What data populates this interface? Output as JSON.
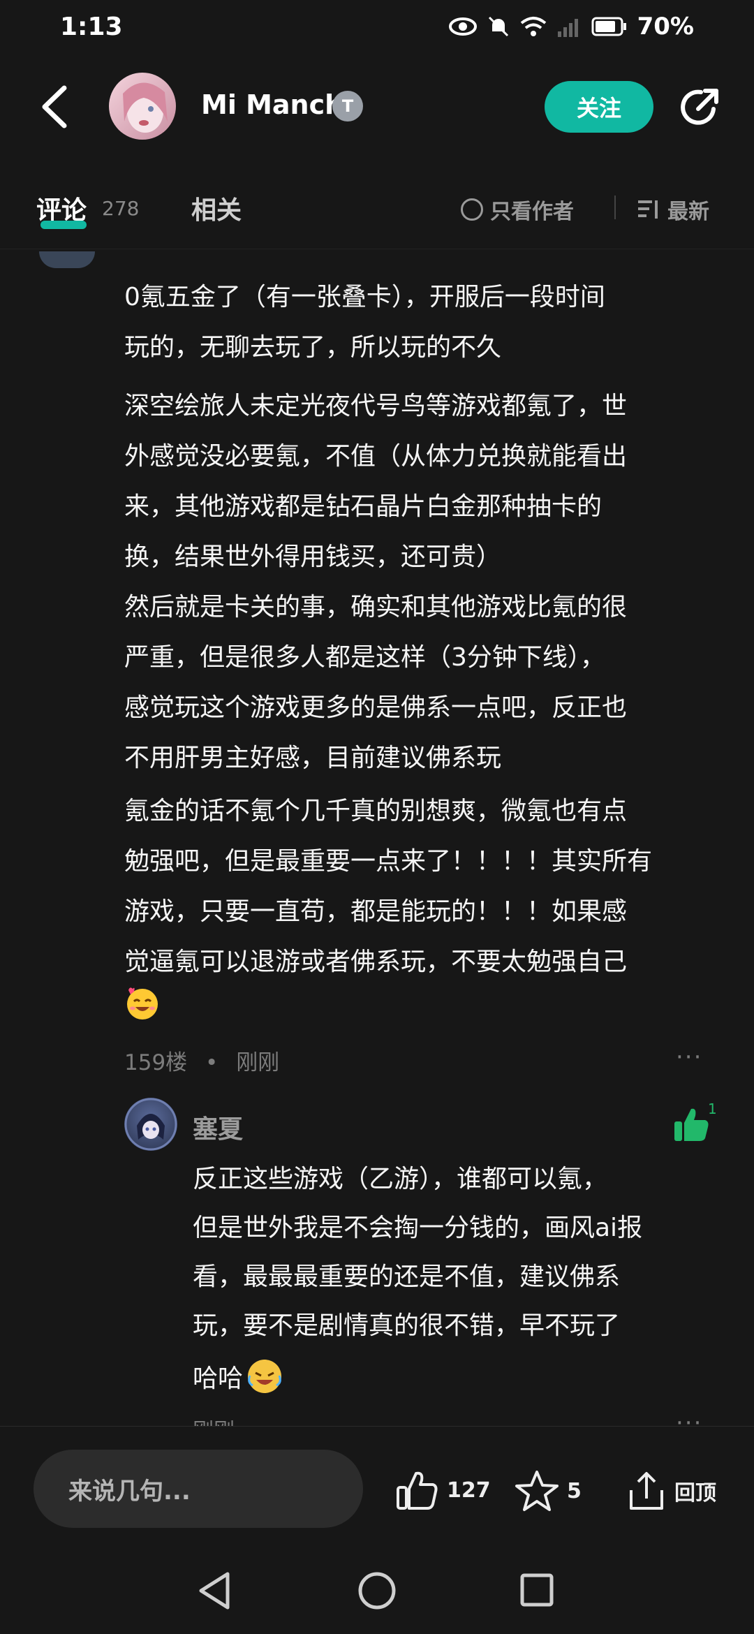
{
  "status_bar": {
    "time": "1:13",
    "battery": "70%"
  },
  "header": {
    "username": "Mi Manchi",
    "follow_label": "关注"
  },
  "tabs": {
    "comments_label": "评论",
    "comments_count": "278",
    "related_label": "相关",
    "only_author_label": "只看作者",
    "sort_label": "最新"
  },
  "comment": {
    "paragraphs": [
      [
        "0氪五金了（有一张叠卡），开服后一段时间",
        "玩的，无聊去玩了，所以玩的不久"
      ],
      [
        "深空绘旅人未定光夜代号鸟等游戏都氪了，世",
        "外感觉没必要氪，不值（从体力兑换就能看出",
        "来，其他游戏都是钻石晶片白金那种抽卡的",
        "换，结果世外得用钱买，还可贵）"
      ],
      [
        "然后就是卡关的事，确实和其他游戏比氪的很",
        "严重，但是很多人都是这样（3分钟下线），",
        "感觉玩这个游戏更多的是佛系一点吧，反正也",
        "不用肝男主好感，目前建议佛系玩"
      ],
      [
        "氪金的话不氪个几千真的别想爽，微氪也有点",
        "勉强吧，但是最重要一点来了！！！！其实所有",
        "游戏，只要一直苟，都是能玩的！！！如果感",
        "觉逼氪可以退游或者佛系玩，不要太勉强自己"
      ]
    ],
    "floor": "159楼",
    "dot": "•",
    "time": "刚刚",
    "more": "···"
  },
  "reply": {
    "name": "塞夏",
    "like_count": "1",
    "lines": [
      "反正这些游戏（乙游），谁都可以氪，",
      "但是世外我是不会掏一分钱的，画风ai报",
      "看，最最最重要的还是不值，建议佛系",
      "玩，要不是剧情真的很不错，早不玩了"
    ],
    "last_line": "哈哈",
    "time": "刚刚",
    "more": "···"
  },
  "bottom_bar": {
    "input_placeholder": "来说几句...",
    "like_count": "127",
    "favorite_count": "5",
    "share_label": "回顶"
  },
  "colors": {
    "accent": "#11b8a2",
    "background": "#171717"
  }
}
